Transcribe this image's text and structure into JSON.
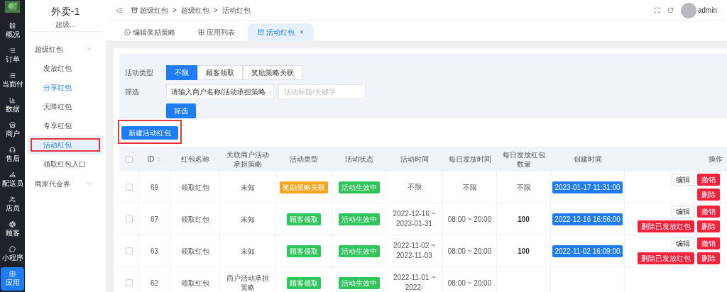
{
  "rail": [
    {
      "label": "概况",
      "selected": false
    },
    {
      "label": "订单",
      "selected": false
    },
    {
      "label": "当面付",
      "selected": false
    },
    {
      "label": "数据",
      "selected": false
    },
    {
      "label": "商户",
      "selected": false
    },
    {
      "label": "售后",
      "selected": false
    },
    {
      "label": "配送员",
      "selected": false
    },
    {
      "label": "店员",
      "selected": false
    },
    {
      "label": "顾客",
      "selected": false
    },
    {
      "label": "小程序",
      "selected": false
    },
    {
      "label": "应用",
      "selected": true
    }
  ],
  "app": {
    "title": "外卖-1",
    "subtitle": "超级..."
  },
  "menu": [
    {
      "label": "超级红包",
      "expanded": true,
      "children": [
        {
          "label": "发放红包",
          "selected": false,
          "highlight": false
        },
        {
          "label": "分享红包",
          "selected": false,
          "highlight": true
        },
        {
          "label": "天降红包",
          "selected": false,
          "highlight": false
        },
        {
          "label": "专享红包",
          "selected": false,
          "highlight": false
        },
        {
          "label": "活动红包",
          "selected": true,
          "highlight": true
        },
        {
          "label": "领取红包入口",
          "selected": false,
          "highlight": false
        }
      ]
    },
    {
      "label": "商家代金券",
      "expanded": false
    }
  ],
  "breadcrumb": [
    "超级红包",
    ">",
    "超级红包",
    ">",
    "活动红包"
  ],
  "user": {
    "name": "admin"
  },
  "tabs": [
    {
      "label": "编辑奖励策略",
      "selected": false
    },
    {
      "label": "应用列表",
      "selected": false
    },
    {
      "label": "活动红包",
      "selected": true,
      "close": "×"
    }
  ],
  "filters": {
    "type_label": "活动类型",
    "types": [
      {
        "label": "不限",
        "selected": true
      },
      {
        "label": "顾客领取",
        "selected": false
      },
      {
        "label": "奖励策略关联",
        "selected": false
      }
    ],
    "filter_label": "筛选",
    "select_placeholder": "请输入商户名称/活动承担策略",
    "keyword_placeholder": "活动标题/关键字",
    "submit": "筛选"
  },
  "new_button": "新建活动红包",
  "table": {
    "all_checked": false,
    "columns": [
      "ID",
      "红包名称",
      "关联商户活动承担策略",
      "活动类型",
      "活动状态",
      "活动时间",
      "每日发放时间",
      "每日发放红包数量",
      "创建时间",
      "操作"
    ],
    "rows": [
      {
        "checked": false,
        "id": "69",
        "name": "领取红包",
        "strategy": "未知",
        "type": {
          "label": "奖励策略关联",
          "color": "#f5a623"
        },
        "status": "活动生效中",
        "time": "不限",
        "daily_time": "不限",
        "count": "不限",
        "count_bold": false,
        "created": "2023-01-17 11:31:00",
        "actions": [
          {
            "label": "编辑",
            "kind": "plain"
          },
          {
            "label": "撤销",
            "kind": "danger"
          },
          {
            "label": "删除",
            "kind": "danger"
          }
        ]
      },
      {
        "checked": false,
        "id": "67",
        "name": "领取红包",
        "strategy": "未知",
        "type": {
          "label": "顾客领取",
          "color": "#2ec55a"
        },
        "status": "活动生效中",
        "time": "2022-12-16 ~ 2023-01-31",
        "daily_time": "08:00 ~ 20:00",
        "count": "100",
        "count_bold": true,
        "created": "2022-12-16 16:56:00",
        "actions": [
          {
            "label": "编辑",
            "kind": "plain"
          },
          {
            "label": "撤销",
            "kind": "danger"
          },
          {
            "label": "删除已发放红包",
            "kind": "danger"
          },
          {
            "label": "删除",
            "kind": "danger"
          }
        ]
      },
      {
        "checked": false,
        "id": "63",
        "name": "领取红包",
        "strategy": "未知",
        "type": {
          "label": "顾客领取",
          "color": "#2ec55a"
        },
        "status": "活动生效中",
        "time": "2022-11-02 ~ 2022-11-03",
        "daily_time": "08:00 ~ 20:00",
        "count": "100",
        "count_bold": true,
        "created": "2022-11-02 16:09:00",
        "actions": [
          {
            "label": "编辑",
            "kind": "plain"
          },
          {
            "label": "撤销",
            "kind": "danger"
          },
          {
            "label": "删除已发放红包",
            "kind": "danger"
          },
          {
            "label": "删除",
            "kind": "danger"
          }
        ]
      },
      {
        "checked": false,
        "id": "62",
        "name": "领取红包",
        "strategy": "商户活动承担策略",
        "type": {
          "label": "顾客领取",
          "color": "#2ec55a"
        },
        "status": "活动生效中",
        "time": "2022-11-01 ~ 2022-",
        "daily_time": "08:00 ~ 20:00"
      }
    ]
  }
}
